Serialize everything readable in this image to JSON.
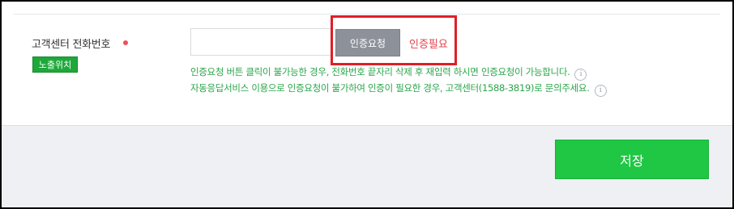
{
  "form": {
    "phone_label": "고객센터 전화번호",
    "exposure_badge": "노출위치",
    "phone_input_value": "",
    "verify_button_label": "인증요청",
    "verify_status": "인증필요",
    "notice_line_1": "인증요청 버튼 클릭이 불가능한 경우, 전화번호 끝자리 삭제 후 재입력 하시면 인증요청이 가능합니다.",
    "notice_line_2": "자동응답서비스 이용으로 인증요청이 불가하여 인증이 필요한 경우, 고객센터(1588-3819)로 문의주세요."
  },
  "footer": {
    "save_label": "저장"
  },
  "icons": {
    "info": "info-circle-icon",
    "required": "required-dot-icon"
  },
  "colors": {
    "save_green": "#1fc744",
    "notice_green": "#2aa64a",
    "status_red": "#e0434c",
    "highlight_red": "#e01e26",
    "verify_gray": "#8d929a"
  }
}
